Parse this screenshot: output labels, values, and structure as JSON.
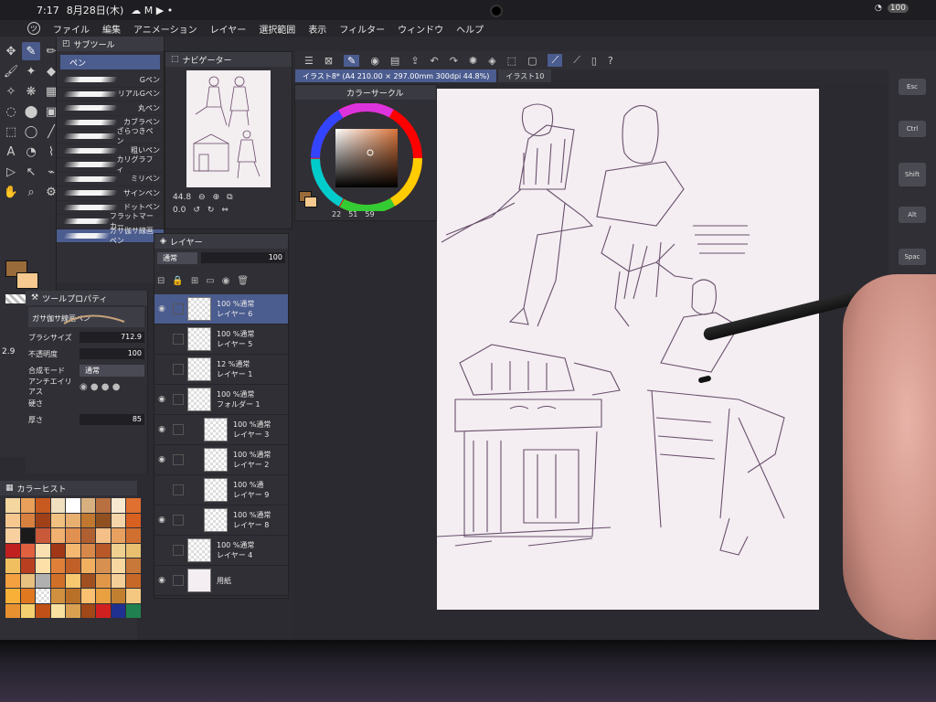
{
  "status": {
    "time": "7:17",
    "date": "8月28日(木)",
    "battery": "100"
  },
  "menu": [
    "ファイル",
    "編集",
    "アニメーション",
    "レイヤー",
    "選択範囲",
    "表示",
    "フィルター",
    "ウィンドウ",
    "ヘルプ"
  ],
  "subtool": {
    "title": "サブツール",
    "category": "ペン",
    "brushes": [
      {
        "label": "Gペン"
      },
      {
        "label": "リアルGペン"
      },
      {
        "label": "丸ペン"
      },
      {
        "label": "カブラペン"
      },
      {
        "label": "ざらつきペン"
      },
      {
        "label": "粗いペン"
      },
      {
        "label": "カリグラフィ"
      },
      {
        "label": "ミリペン"
      },
      {
        "label": "サインペン"
      },
      {
        "label": "ドットペン"
      },
      {
        "label": "フラットマーカー"
      },
      {
        "label": "ガサ伽サ線画ペン"
      }
    ]
  },
  "toolprop": {
    "title": "ツールプロパティ",
    "brush_name": "ガサ伽サ線画ペン",
    "size_label": "ブラシサイズ",
    "size_value": "712.9",
    "opacity_label": "不透明度",
    "opacity_value": "100",
    "blend_label": "合成モード",
    "blend_value": "通常",
    "aa_label": "アンチエイリアス",
    "hardness_label": "硬さ",
    "thickness_label": "厚さ",
    "thickness_value": "85",
    "side_size": "2.9"
  },
  "colorhist": {
    "title": "カラーヒスト"
  },
  "navigator": {
    "title": "ナビゲーター",
    "zoom": "44.8",
    "rotation": "0.0"
  },
  "colorcircle": {
    "title": "カラーサークル",
    "h": "22",
    "s": "51",
    "v": "59"
  },
  "layers": {
    "title": "レイヤー",
    "blend": "通常",
    "opacity": "100",
    "items": [
      {
        "mode": "100 %通常",
        "name": "レイヤー 6"
      },
      {
        "mode": "100 %通常",
        "name": "レイヤー 5"
      },
      {
        "mode": "12 %通常",
        "name": "レイヤー 1"
      },
      {
        "mode": "100 %通常",
        "name": "フォルダー 1"
      },
      {
        "mode": "100 %通常",
        "name": "レイヤー 3"
      },
      {
        "mode": "100 %通常",
        "name": "レイヤー 2"
      },
      {
        "mode": "100 %通",
        "name": "レイヤー 9"
      },
      {
        "mode": "100 %通常",
        "name": "レイヤー 8"
      },
      {
        "mode": "100 %通常",
        "name": "レイヤー 4"
      },
      {
        "mode": "",
        "name": "用紙"
      }
    ]
  },
  "doc": {
    "tab_active": "イラスト8* (A4 210.00 × 297.00mm 300dpi 44.8%)",
    "tab_other": "イラスト10"
  },
  "keys": [
    "Esc",
    "Ctrl",
    "Shift",
    "Alt",
    "Spac"
  ],
  "colors": {
    "main": "#9a6b3a",
    "sub": "#f5c98f",
    "accent": "#4b5c8f"
  }
}
